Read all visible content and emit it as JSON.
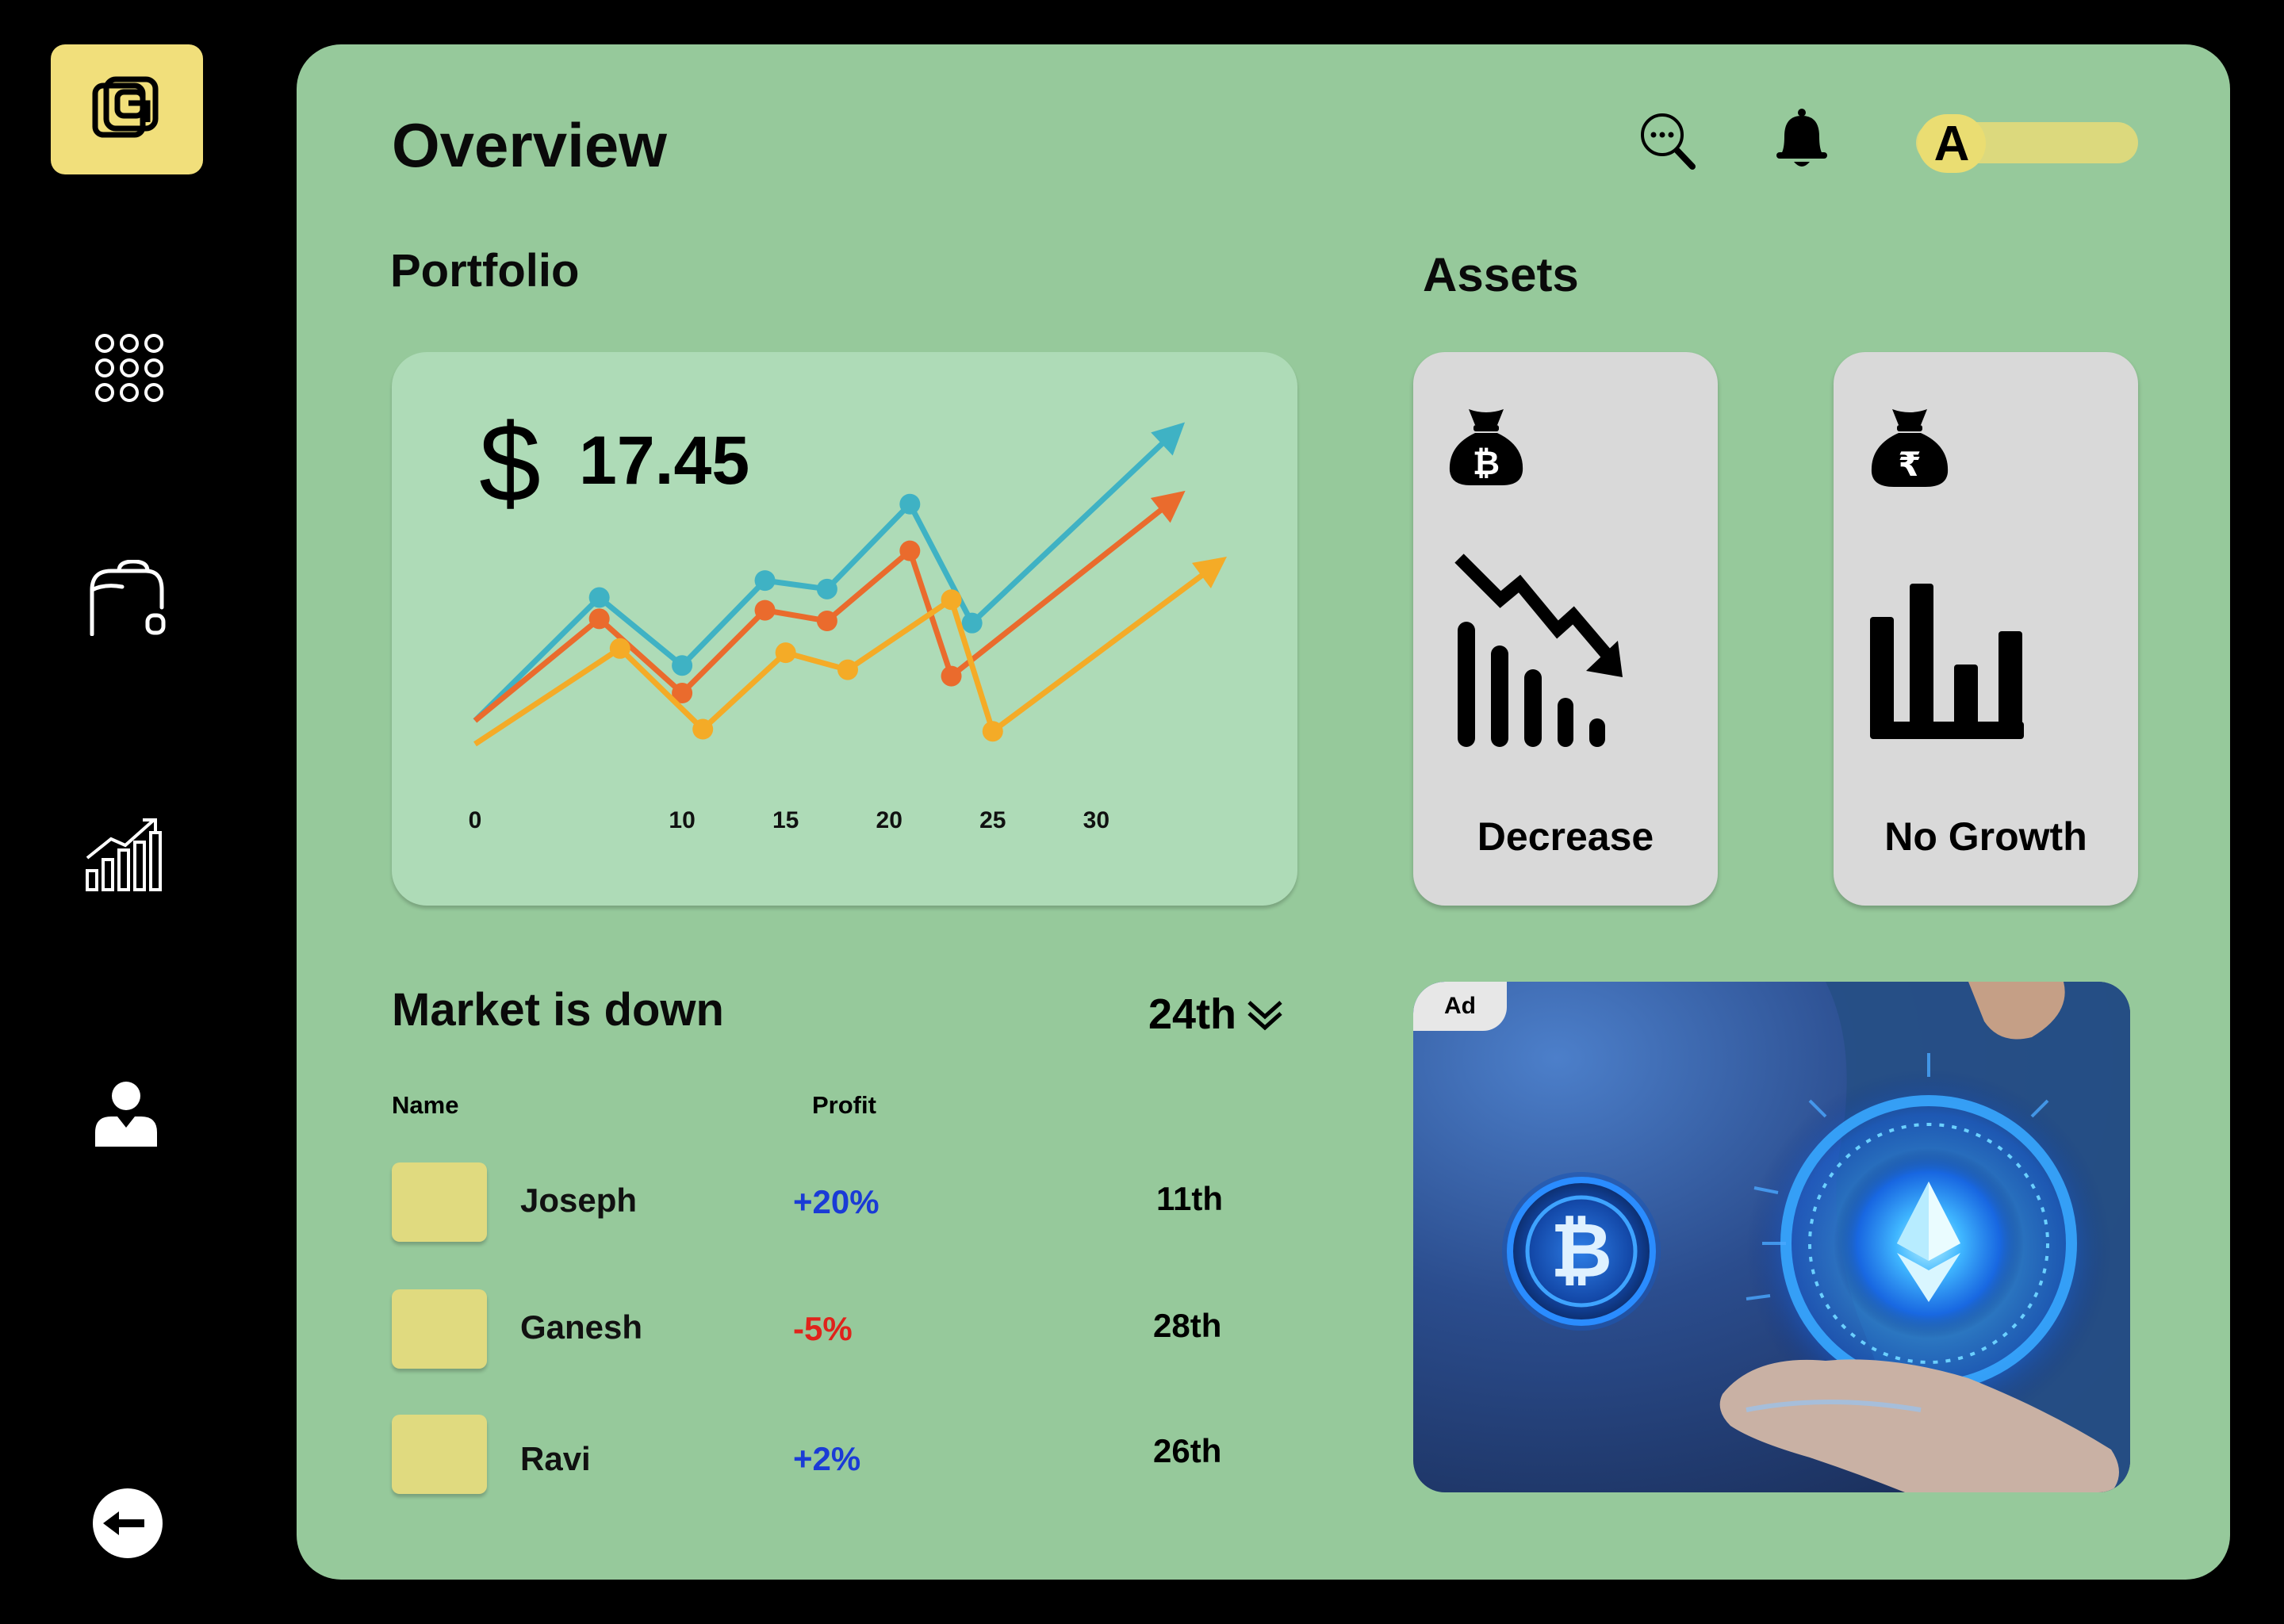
{
  "header": {
    "title": "Overview",
    "avatar_initial": "A"
  },
  "sidebar": {
    "items": [
      {
        "name": "apps",
        "icon": "grid-dots-icon"
      },
      {
        "name": "wallet",
        "icon": "wallet-icon"
      },
      {
        "name": "analytics",
        "icon": "bar-chart-up-icon"
      },
      {
        "name": "profile",
        "icon": "user-icon"
      },
      {
        "name": "logout",
        "icon": "back-arrow-icon"
      }
    ]
  },
  "portfolio": {
    "title": "Portfolio",
    "currency_symbol": "$",
    "amount": "17.45"
  },
  "chart_data": {
    "type": "line",
    "x_tick_labels": [
      "0",
      "10",
      "15",
      "20",
      "25",
      "30"
    ],
    "series": [
      {
        "color": "#3fb2c4",
        "points": [
          [
            0,
            0
          ],
          [
            6,
            58
          ],
          [
            10,
            26
          ],
          [
            14,
            66
          ],
          [
            17,
            62
          ],
          [
            21,
            102
          ],
          [
            24,
            46
          ],
          [
            34,
            138
          ]
        ]
      },
      {
        "color": "#ea6b2d",
        "points": [
          [
            0,
            0
          ],
          [
            6,
            48
          ],
          [
            10,
            13
          ],
          [
            14,
            52
          ],
          [
            17,
            47
          ],
          [
            21,
            80
          ],
          [
            23,
            21
          ],
          [
            34,
            106
          ]
        ]
      },
      {
        "color": "#f4ab27",
        "points": [
          [
            0,
            -11
          ],
          [
            7,
            34
          ],
          [
            11,
            -4
          ],
          [
            15,
            32
          ],
          [
            18,
            24
          ],
          [
            23,
            57
          ],
          [
            25,
            -5
          ],
          [
            36,
            75
          ]
        ]
      }
    ],
    "xlim": [
      0,
      36
    ],
    "ylim": [
      -15,
      140
    ],
    "grid": false,
    "legend": "none"
  },
  "assets": {
    "title": "Assets",
    "cards": [
      {
        "label": "Decrease",
        "coin": "bitcoin-money-bag-icon",
        "chart": "declining-bars-icon"
      },
      {
        "label": "No Growth",
        "coin": "rupee-money-bag-icon",
        "chart": "flat-bars-icon"
      }
    ]
  },
  "market": {
    "title": "Market is down",
    "filter_label": "24th",
    "columns": {
      "name": "Name",
      "profit": "Profit"
    },
    "rows": [
      {
        "name": "Joseph",
        "profit": "+20%",
        "date": "11th",
        "trend": "up"
      },
      {
        "name": "Ganesh",
        "profit": "-5%",
        "date": "28th",
        "trend": "down"
      },
      {
        "name": "Ravi",
        "profit": "+2%",
        "date": "26th",
        "trend": "up"
      }
    ]
  },
  "ad": {
    "badge": "Ad"
  },
  "colors": {
    "panel": "#96c99b",
    "accent_yellow": "#f1df7b",
    "positive": "#1a3bd6",
    "negative": "#e0231b"
  }
}
